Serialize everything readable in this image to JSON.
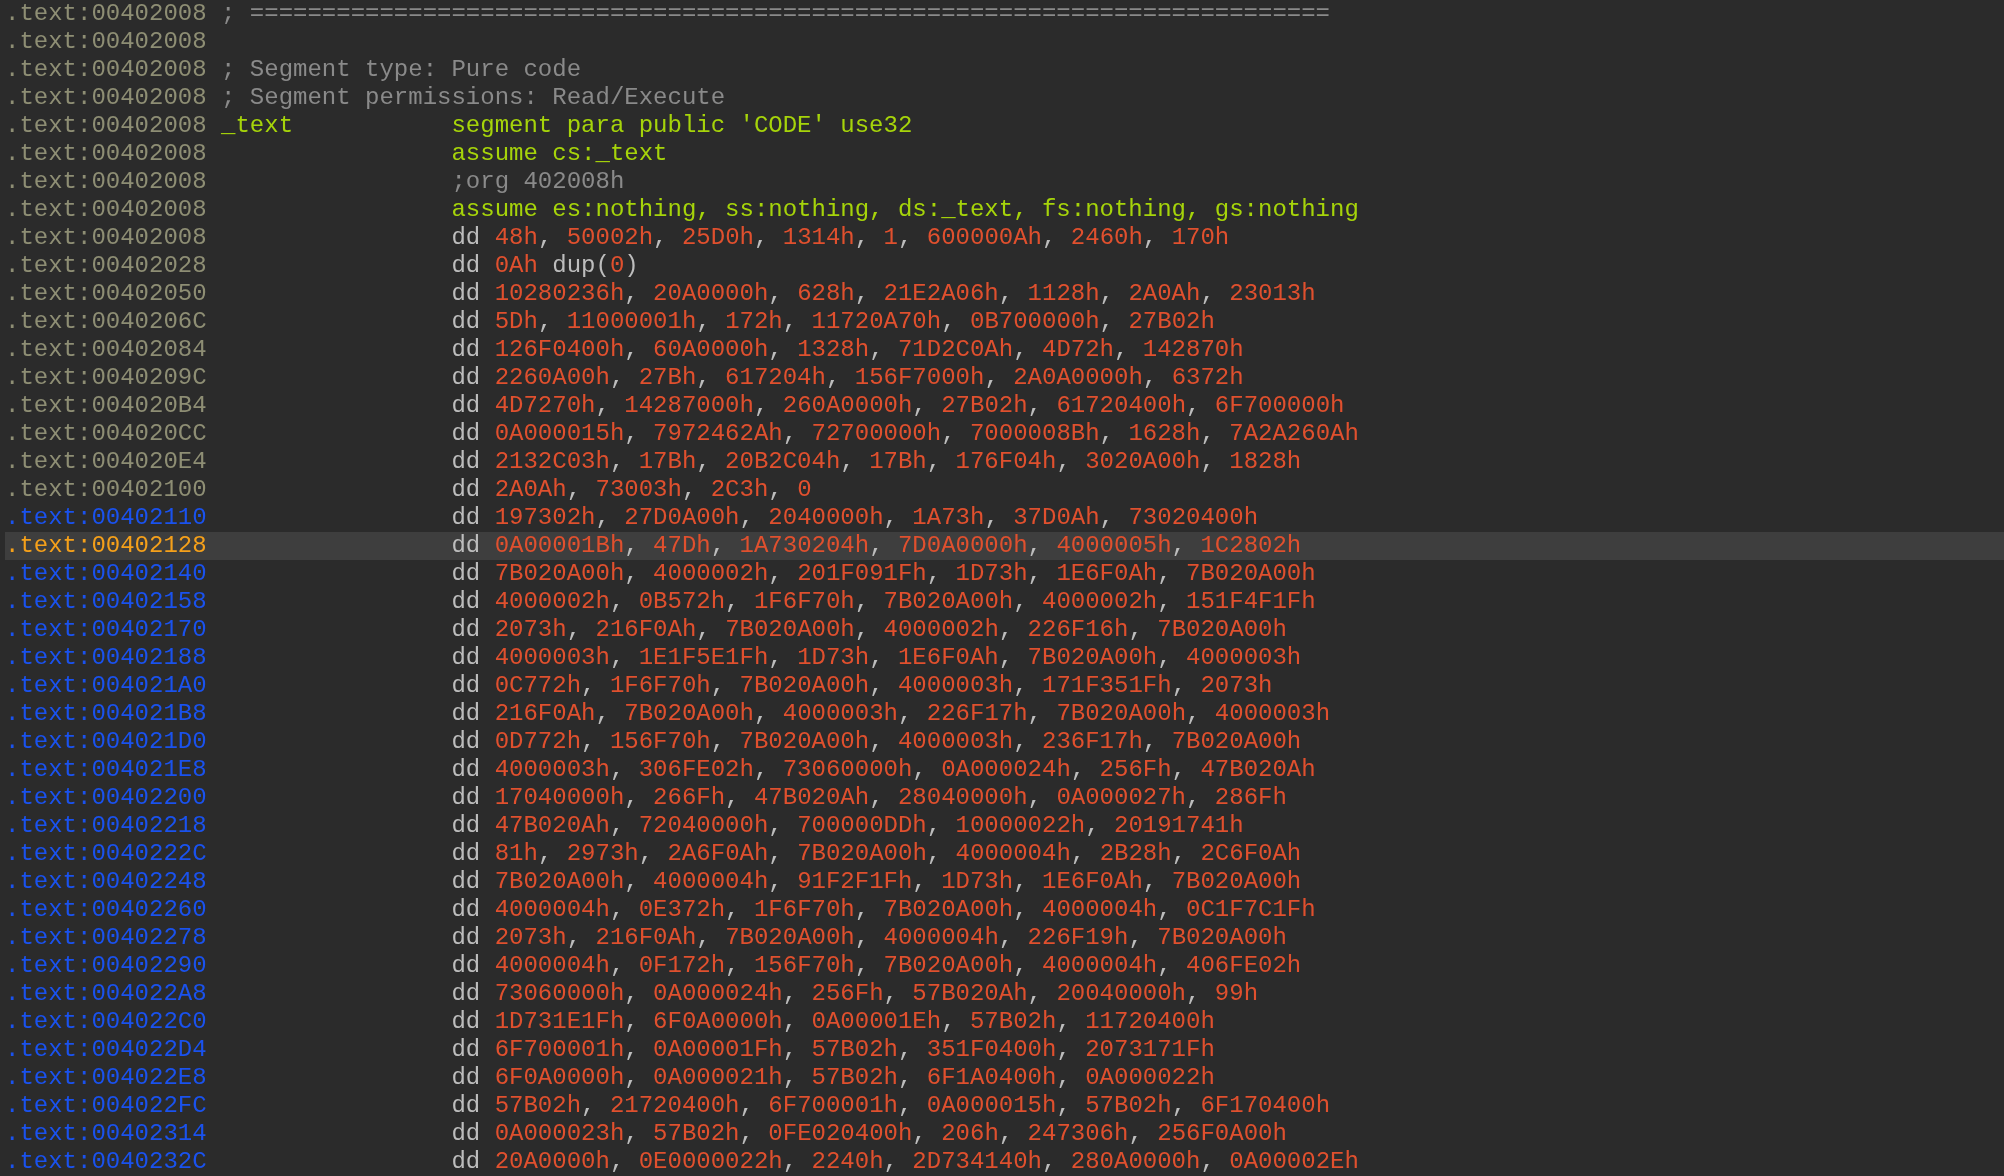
{
  "lines": [
    {
      "address": ".text:00402008",
      "color": "#8e8e74",
      "selected": false,
      "kind": "comment",
      "text": "; ==========================================================================="
    },
    {
      "address": ".text:00402008",
      "color": "#8e8e74",
      "selected": false,
      "kind": "blank"
    },
    {
      "address": ".text:00402008",
      "color": "#8e8e74",
      "selected": false,
      "kind": "comment",
      "text": "; Segment type: Pure code"
    },
    {
      "address": ".text:00402008",
      "color": "#8e8e74",
      "selected": false,
      "kind": "comment",
      "text": "; Segment permissions: Read/Execute"
    },
    {
      "address": ".text:00402008",
      "color": "#8e8e74",
      "selected": false,
      "kind": "directive",
      "label": "_text",
      "text": "segment para public 'CODE' use32"
    },
    {
      "address": ".text:00402008",
      "color": "#8e8e74",
      "selected": false,
      "kind": "directive",
      "text": "assume cs:_text"
    },
    {
      "address": ".text:00402008",
      "color": "#8e8e74",
      "selected": false,
      "kind": "note",
      "text": ";org 402008h"
    },
    {
      "address": ".text:00402008",
      "color": "#8e8e74",
      "selected": false,
      "kind": "directive",
      "text": "assume es:nothing, ss:nothing, ds:_text, fs:nothing, gs:nothing"
    },
    {
      "address": ".text:00402008",
      "color": "#8e8e74",
      "selected": false,
      "kind": "data",
      "mnemonic": "dd",
      "operands": "48h, 50002h, 25D0h, 1314h, 1, 600000Ah, 2460h, 170h"
    },
    {
      "address": ".text:00402028",
      "color": "#8e8e74",
      "selected": false,
      "kind": "data",
      "mnemonic": "dd",
      "operands": "0Ah dup(0)"
    },
    {
      "address": ".text:00402050",
      "color": "#8e8e74",
      "selected": false,
      "kind": "data",
      "mnemonic": "dd",
      "operands": "10280236h, 20A0000h, 628h, 21E2A06h, 1128h, 2A0Ah, 23013h"
    },
    {
      "address": ".text:0040206C",
      "color": "#8e8e74",
      "selected": false,
      "kind": "data",
      "mnemonic": "dd",
      "operands": "5Dh, 11000001h, 172h, 11720A70h, 0B700000h, 27B02h"
    },
    {
      "address": ".text:00402084",
      "color": "#8e8e74",
      "selected": false,
      "kind": "data",
      "mnemonic": "dd",
      "operands": "126F0400h, 60A0000h, 1328h, 71D2C0Ah, 4D72h, 142870h"
    },
    {
      "address": ".text:0040209C",
      "color": "#8e8e74",
      "selected": false,
      "kind": "data",
      "mnemonic": "dd",
      "operands": "2260A00h, 27Bh, 617204h, 156F7000h, 2A0A0000h, 6372h"
    },
    {
      "address": ".text:004020B4",
      "color": "#8e8e74",
      "selected": false,
      "kind": "data",
      "mnemonic": "dd",
      "operands": "4D7270h, 14287000h, 260A0000h, 27B02h, 61720400h, 6F700000h"
    },
    {
      "address": ".text:004020CC",
      "color": "#8e8e74",
      "selected": false,
      "kind": "data",
      "mnemonic": "dd",
      "operands": "0A000015h, 7972462Ah, 72700000h, 7000008Bh, 1628h, 7A2A260Ah"
    },
    {
      "address": ".text:004020E4",
      "color": "#8e8e74",
      "selected": false,
      "kind": "data",
      "mnemonic": "dd",
      "operands": "2132C03h, 17Bh, 20B2C04h, 17Bh, 176F04h, 3020A00h, 1828h"
    },
    {
      "address": ".text:00402100",
      "color": "#8e8e74",
      "selected": false,
      "kind": "data",
      "mnemonic": "dd",
      "operands": "2A0Ah, 73003h, 2C3h, 0"
    },
    {
      "address": ".text:00402110",
      "color": "#1a52ee",
      "selected": false,
      "kind": "data",
      "mnemonic": "dd",
      "operands": "197302h, 27D0A00h, 2040000h, 1A73h, 37D0Ah, 73020400h"
    },
    {
      "address": ".text:00402128",
      "color": "#f5a01a",
      "selected": true,
      "kind": "data",
      "mnemonic": "dd",
      "operands": "0A00001Bh, 47Dh, 1A730204h, 7D0A0000h, 4000005h, 1C2802h"
    },
    {
      "address": ".text:00402140",
      "color": "#1a52ee",
      "selected": false,
      "kind": "data",
      "mnemonic": "dd",
      "operands": "7B020A00h, 4000002h, 201F091Fh, 1D73h, 1E6F0Ah, 7B020A00h"
    },
    {
      "address": ".text:00402158",
      "color": "#1a52ee",
      "selected": false,
      "kind": "data",
      "mnemonic": "dd",
      "operands": "4000002h, 0B572h, 1F6F70h, 7B020A00h, 4000002h, 151F4F1Fh"
    },
    {
      "address": ".text:00402170",
      "color": "#1a52ee",
      "selected": false,
      "kind": "data",
      "mnemonic": "dd",
      "operands": "2073h, 216F0Ah, 7B020A00h, 4000002h, 226F16h, 7B020A00h"
    },
    {
      "address": ".text:00402188",
      "color": "#1a52ee",
      "selected": false,
      "kind": "data",
      "mnemonic": "dd",
      "operands": "4000003h, 1E1F5E1Fh, 1D73h, 1E6F0Ah, 7B020A00h, 4000003h"
    },
    {
      "address": ".text:004021A0",
      "color": "#1a52ee",
      "selected": false,
      "kind": "data",
      "mnemonic": "dd",
      "operands": "0C772h, 1F6F70h, 7B020A00h, 4000003h, 171F351Fh, 2073h"
    },
    {
      "address": ".text:004021B8",
      "color": "#1a52ee",
      "selected": false,
      "kind": "data",
      "mnemonic": "dd",
      "operands": "216F0Ah, 7B020A00h, 4000003h, 226F17h, 7B020A00h, 4000003h"
    },
    {
      "address": ".text:004021D0",
      "color": "#1a52ee",
      "selected": false,
      "kind": "data",
      "mnemonic": "dd",
      "operands": "0D772h, 156F70h, 7B020A00h, 4000003h, 236F17h, 7B020A00h"
    },
    {
      "address": ".text:004021E8",
      "color": "#1a52ee",
      "selected": false,
      "kind": "data",
      "mnemonic": "dd",
      "operands": "4000003h, 306FE02h, 73060000h, 0A000024h, 256Fh, 47B020Ah"
    },
    {
      "address": ".text:00402200",
      "color": "#1a52ee",
      "selected": false,
      "kind": "data",
      "mnemonic": "dd",
      "operands": "17040000h, 266Fh, 47B020Ah, 28040000h, 0A000027h, 286Fh"
    },
    {
      "address": ".text:00402218",
      "color": "#1a52ee",
      "selected": false,
      "kind": "data",
      "mnemonic": "dd",
      "operands": "47B020Ah, 72040000h, 700000DDh, 10000022h, 20191741h"
    },
    {
      "address": ".text:0040222C",
      "color": "#1a52ee",
      "selected": false,
      "kind": "data",
      "mnemonic": "dd",
      "operands": "81h, 2973h, 2A6F0Ah, 7B020A00h, 4000004h, 2B28h, 2C6F0Ah"
    },
    {
      "address": ".text:00402248",
      "color": "#1a52ee",
      "selected": false,
      "kind": "data",
      "mnemonic": "dd",
      "operands": "7B020A00h, 4000004h, 91F2F1Fh, 1D73h, 1E6F0Ah, 7B020A00h"
    },
    {
      "address": ".text:00402260",
      "color": "#1a52ee",
      "selected": false,
      "kind": "data",
      "mnemonic": "dd",
      "operands": "4000004h, 0E372h, 1F6F70h, 7B020A00h, 4000004h, 0C1F7C1Fh"
    },
    {
      "address": ".text:00402278",
      "color": "#1a52ee",
      "selected": false,
      "kind": "data",
      "mnemonic": "dd",
      "operands": "2073h, 216F0Ah, 7B020A00h, 4000004h, 226F19h, 7B020A00h"
    },
    {
      "address": ".text:00402290",
      "color": "#1a52ee",
      "selected": false,
      "kind": "data",
      "mnemonic": "dd",
      "operands": "4000004h, 0F172h, 156F70h, 7B020A00h, 4000004h, 406FE02h"
    },
    {
      "address": ".text:004022A8",
      "color": "#1a52ee",
      "selected": false,
      "kind": "data",
      "mnemonic": "dd",
      "operands": "73060000h, 0A000024h, 256Fh, 57B020Ah, 20040000h, 99h"
    },
    {
      "address": ".text:004022C0",
      "color": "#1a52ee",
      "selected": false,
      "kind": "data",
      "mnemonic": "dd",
      "operands": "1D731E1Fh, 6F0A0000h, 0A00001Eh, 57B02h, 11720400h"
    },
    {
      "address": ".text:004022D4",
      "color": "#1a52ee",
      "selected": false,
      "kind": "data",
      "mnemonic": "dd",
      "operands": "6F700001h, 0A00001Fh, 57B02h, 351F0400h, 2073171Fh"
    },
    {
      "address": ".text:004022E8",
      "color": "#1a52ee",
      "selected": false,
      "kind": "data",
      "mnemonic": "dd",
      "operands": "6F0A0000h, 0A000021h, 57B02h, 6F1A0400h, 0A000022h"
    },
    {
      "address": ".text:004022FC",
      "color": "#1a52ee",
      "selected": false,
      "kind": "data",
      "mnemonic": "dd",
      "operands": "57B02h, 21720400h, 6F700001h, 0A000015h, 57B02h, 6F170400h"
    },
    {
      "address": ".text:00402314",
      "color": "#1a52ee",
      "selected": false,
      "kind": "data",
      "mnemonic": "dd",
      "operands": "0A000023h, 57B02h, 0FE020400h, 206h, 247306h, 256F0A00h"
    },
    {
      "address": ".text:0040232C",
      "color": "#1a52ee",
      "selected": false,
      "kind": "data",
      "mnemonic": "dd",
      "operands": "20A0000h, 0E0000022h, 2240h, 2D734140h, 280A0000h, 0A00002Eh"
    }
  ]
}
